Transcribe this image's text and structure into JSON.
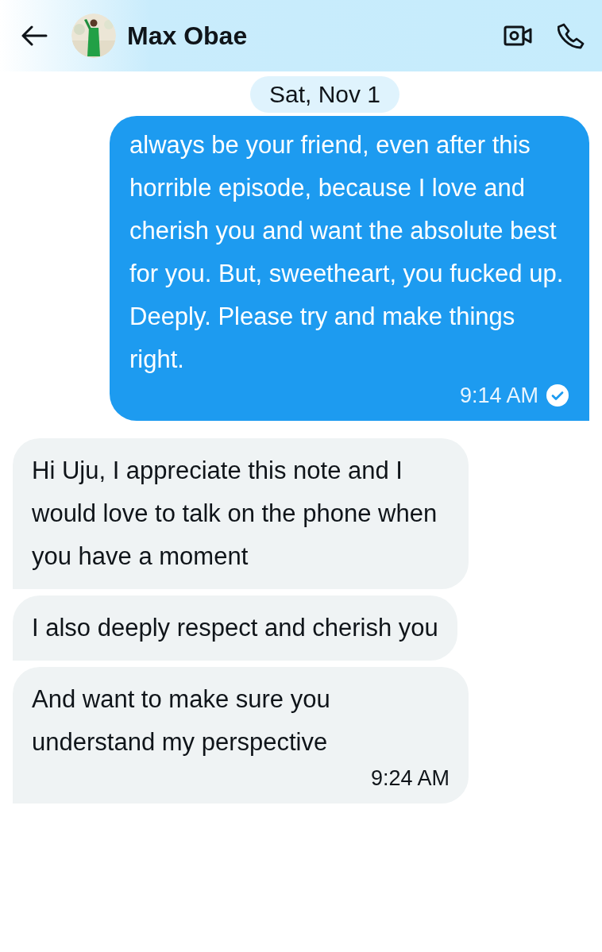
{
  "header": {
    "contact_name": "Max Obae"
  },
  "date_separator": "Sat, Nov 1",
  "messages": [
    {
      "kind": "sent",
      "text": "always be your friend, even after this horrible episode, because I love and cherish you and want the absolute best for you. But, sweetheart, you fucked up. Deeply. Please try and make things right.",
      "time": "9:14 AM",
      "read": true
    },
    {
      "kind": "received",
      "text": "Hi Uju, I appreciate this note and I would love to talk on the phone when you have a moment"
    },
    {
      "kind": "received",
      "text": "I also deeply respect and cherish you"
    },
    {
      "kind": "received",
      "text": "And want to make sure you understand my perspective",
      "time": "9:24 AM"
    }
  ]
}
